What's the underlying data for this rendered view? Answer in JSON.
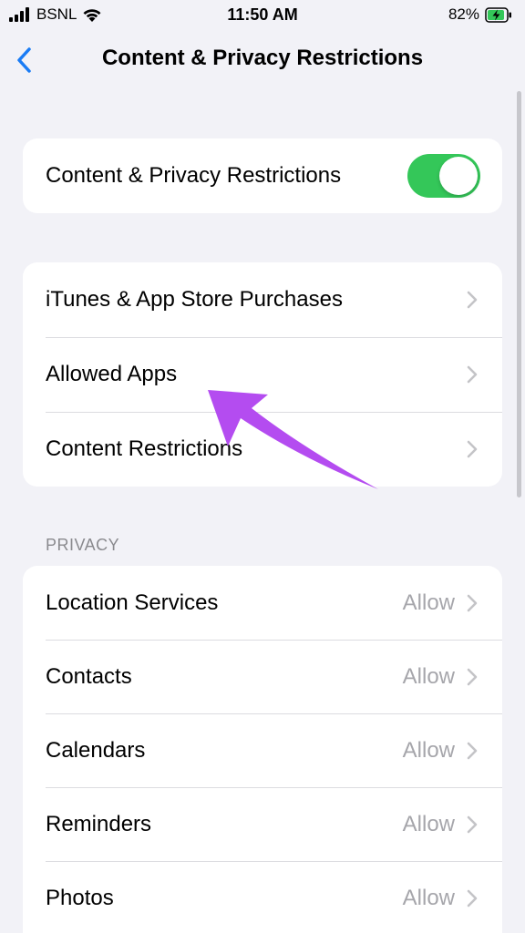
{
  "status_bar": {
    "carrier": "BSNL",
    "time": "11:50 AM",
    "battery_percent": "82%",
    "signal_icon": "signal-bars-icon",
    "wifi_icon": "wifi-icon",
    "battery_icon": "battery-charging-icon"
  },
  "nav": {
    "title": "Content & Privacy Restrictions",
    "back_icon": "chevron-left-icon"
  },
  "main_toggle": {
    "label": "Content & Privacy Restrictions",
    "on": true
  },
  "store_group": {
    "items": [
      {
        "label": "iTunes & App Store Purchases"
      },
      {
        "label": "Allowed Apps"
      },
      {
        "label": "Content Restrictions"
      }
    ]
  },
  "privacy": {
    "header": "PRIVACY",
    "items": [
      {
        "label": "Location Services",
        "value": "Allow"
      },
      {
        "label": "Contacts",
        "value": "Allow"
      },
      {
        "label": "Calendars",
        "value": "Allow"
      },
      {
        "label": "Reminders",
        "value": "Allow"
      },
      {
        "label": "Photos",
        "value": "Allow"
      }
    ]
  },
  "colors": {
    "accent_blue": "#1a7cf5",
    "toggle_green": "#34c759",
    "annotation_arrow": "#b44cf0",
    "background": "#f2f2f7"
  }
}
